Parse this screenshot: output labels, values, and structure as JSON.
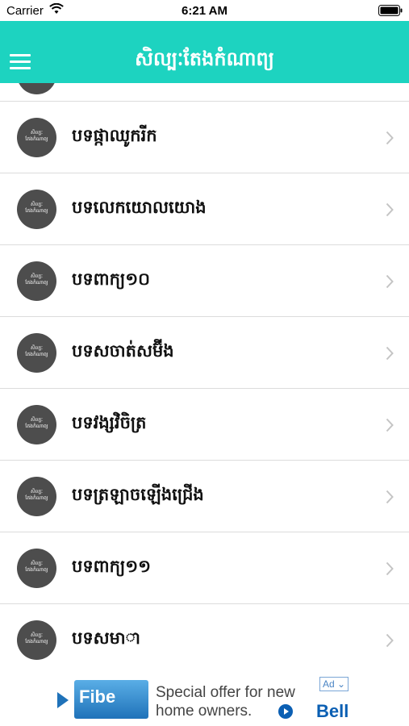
{
  "status_bar": {
    "carrier": "Carrier",
    "time": "6:21 AM"
  },
  "header": {
    "title": "សិល្បៈតែងកំណាព្យ"
  },
  "avatar_text": {
    "line1": "សិល្បៈ",
    "line2": "តែងកំណាព្យ"
  },
  "list": {
    "items": [
      {
        "label": "បទផ្កាឈូករីក"
      },
      {
        "label": "បទលេកយោលយោង"
      },
      {
        "label": "បទពាក្យ១០"
      },
      {
        "label": "បទសចាត់សម៊ីង"
      },
      {
        "label": "បទវង្សវិចិត្រ"
      },
      {
        "label": "បទត្រឡាចឡើងជ្រើង"
      },
      {
        "label": "បទពាក្យ១១"
      },
      {
        "label": "បទសមាា"
      }
    ]
  },
  "ad": {
    "logo_text": "Fibe",
    "line1": "Special offer for new",
    "line2": "home owners.",
    "brand": "Bell",
    "badge": "Ad"
  },
  "colors": {
    "accent": "#1dd3c0",
    "avatar_bg": "#4d4d4d",
    "divider": "#dcdcdc"
  }
}
